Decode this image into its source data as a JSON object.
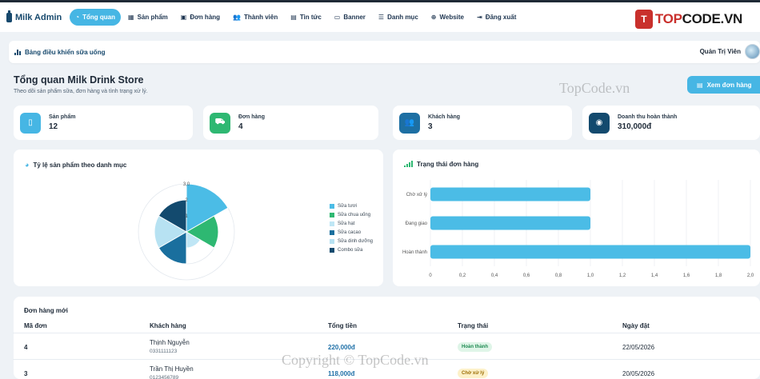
{
  "brand": "Milk Admin",
  "nav": [
    {
      "label": "Tổng quan",
      "icon": "dashboard-icon",
      "glyph": "◔",
      "active": true
    },
    {
      "label": "Sản phẩm",
      "icon": "boxes-icon",
      "glyph": "▦"
    },
    {
      "label": "Đơn hàng",
      "icon": "truck-icon",
      "glyph": "▣"
    },
    {
      "label": "Thành viên",
      "icon": "users-icon",
      "glyph": "👥"
    },
    {
      "label": "Tin tức",
      "icon": "newspaper-icon",
      "glyph": "▤"
    },
    {
      "label": "Banner",
      "icon": "image-icon",
      "glyph": "▭"
    },
    {
      "label": "Danh mục",
      "icon": "list-icon",
      "glyph": "☰"
    },
    {
      "label": "Website",
      "icon": "globe-icon",
      "glyph": "⊕"
    },
    {
      "label": "Đăng xuất",
      "icon": "logout-icon",
      "glyph": "⇥"
    }
  ],
  "logo": {
    "mark": "T",
    "text_a": "TOP",
    "text_b": "CODE.VN"
  },
  "subbar": {
    "title": "Bảng điều khiển sữa uống",
    "user": "Quản Trị Viên"
  },
  "page": {
    "title": "Tổng quan Milk Drink Store",
    "subtitle": "Theo dõi sản phẩm sữa, đơn hàng và tình trạng xử lý.",
    "view_orders": "Xem đơn hàng",
    "watermark": "TopCode.vn"
  },
  "stats": [
    {
      "label": "Sản phẩm",
      "value": "12",
      "color": "#46b6e4",
      "icon": "bottle-icon",
      "glyph": "▯"
    },
    {
      "label": "Đơn hàng",
      "value": "4",
      "color": "#2eb872",
      "icon": "cart-icon",
      "glyph": "⛟"
    },
    {
      "label": "Khách hàng",
      "value": "3",
      "color": "#1d6fa3",
      "icon": "customers-icon",
      "glyph": "👥"
    },
    {
      "label": "Doanh thu hoàn thành",
      "value": "310,000đ",
      "color": "#134a6e",
      "icon": "coins-icon",
      "glyph": "◉"
    }
  ],
  "pie_panel": {
    "title": "Tỷ lệ sản phẩm theo danh mục"
  },
  "bar_panel": {
    "title": "Trạng thái đơn hàng"
  },
  "chart_data": [
    {
      "type": "pie",
      "subtype": "polar-area",
      "title": "Tỷ lệ sản phẩm theo danh mục",
      "categories": [
        "Sữa tươi",
        "Sữa chua uống",
        "Sữa hạt",
        "Sữa cacao",
        "Sữa dinh dưỡng",
        "Combo sữa"
      ],
      "values": [
        3,
        2,
        1,
        2,
        2,
        2
      ],
      "colors": [
        "#4bbce6",
        "#2eb872",
        "#bfe6f5",
        "#1a6f9e",
        "#b7e2f2",
        "#134a6e"
      ],
      "r_ticks": [
        "3,0",
        "2",
        "1"
      ],
      "rlim": [
        0,
        3
      ],
      "legend": "right"
    },
    {
      "type": "bar",
      "orientation": "horizontal",
      "title": "Trạng thái đơn hàng",
      "categories": [
        "Chờ xử lý",
        "Đang giao",
        "Hoàn thành"
      ],
      "values": [
        1,
        1,
        2
      ],
      "color": "#4bbce6",
      "xlim": [
        0,
        2
      ],
      "x_ticks": [
        "0",
        "0,2",
        "0,4",
        "0,6",
        "0,8",
        "1,0",
        "1,2",
        "1,4",
        "1,6",
        "1,8",
        "2,0"
      ],
      "grid": true
    }
  ],
  "orders": {
    "title": "Đơn hàng mới",
    "columns": [
      "Mã đơn",
      "Khách hàng",
      "Tổng tiền",
      "Trạng thái",
      "Ngày đặt"
    ],
    "rows": [
      {
        "id": "4",
        "name": "Thịnh Nguyễn",
        "phone": "0331111123",
        "total": "220,000đ",
        "status": "Hoàn thành",
        "status_bg": "#dff5e8",
        "status_fg": "#1e8a52",
        "date": "22/05/2026"
      },
      {
        "id": "3",
        "name": "Trần Thị Huyền",
        "phone": "0123456789",
        "total": "118,000đ",
        "status": "Chờ xử lý",
        "status_bg": "#fdf1c9",
        "status_fg": "#9a6b00",
        "date": "20/05/2026"
      }
    ],
    "watermark": "Copyright © TopCode.vn"
  }
}
